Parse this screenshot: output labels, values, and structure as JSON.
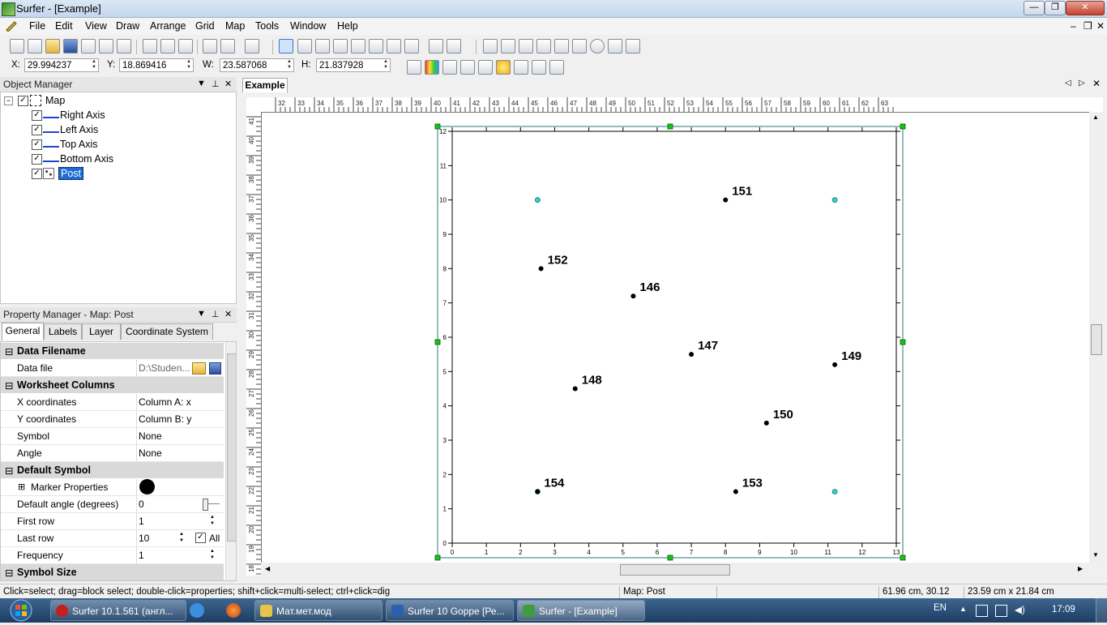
{
  "window": {
    "title": "Surfer - [Example]",
    "controls": {
      "minimize": "—",
      "maximize": "❐",
      "close": "✕"
    }
  },
  "menu": [
    "File",
    "Edit",
    "View",
    "Draw",
    "Arrange",
    "Grid",
    "Map",
    "Tools",
    "Window",
    "Help"
  ],
  "mdi_controls": {
    "minimize": "–",
    "restore": "❐",
    "close": "✕"
  },
  "coords": {
    "x_label": "X:",
    "x_value": "29.994237",
    "y_label": "Y:",
    "y_value": "18.869416",
    "w_label": "W:",
    "w_value": "23.587068",
    "h_label": "H:",
    "h_value": "21.837928"
  },
  "object_manager": {
    "title": "Object Manager",
    "items": [
      {
        "label": "Map",
        "checked": true
      },
      {
        "label": "Right Axis",
        "checked": true
      },
      {
        "label": "Left Axis",
        "checked": true
      },
      {
        "label": "Top Axis",
        "checked": true
      },
      {
        "label": "Bottom Axis",
        "checked": true
      },
      {
        "label": "Post",
        "checked": true,
        "selected": true
      }
    ]
  },
  "property_manager": {
    "title": "Property Manager - Map: Post",
    "tabs": [
      "General",
      "Labels",
      "Layer",
      "Coordinate System"
    ],
    "active_tab": "General",
    "sections": {
      "data_filename": "Data Filename",
      "worksheet_columns": "Worksheet Columns",
      "default_symbol": "Default Symbol",
      "symbol_size": "Symbol Size"
    },
    "rows": {
      "data_file": {
        "name": "Data file",
        "value": "D:\\Studen..."
      },
      "x_coords": {
        "name": "X coordinates",
        "value": "Column A:  x"
      },
      "y_coords": {
        "name": "Y coordinates",
        "value": "Column B:  y"
      },
      "symbol": {
        "name": "Symbol",
        "value": "None"
      },
      "angle": {
        "name": "Angle",
        "value": "None"
      },
      "marker": {
        "name": "Marker Properties"
      },
      "default_angle": {
        "name": "Default angle (degrees)",
        "value": "0"
      },
      "first_row": {
        "name": "First row",
        "value": "1"
      },
      "last_row": {
        "name": "Last row",
        "value": "10",
        "all_label": "All"
      },
      "frequency": {
        "name": "Frequency",
        "value": "1"
      }
    }
  },
  "document": {
    "tab": "Example"
  },
  "ruler": {
    "top": [
      "32",
      "33",
      "34",
      "35",
      "36",
      "37",
      "38",
      "39",
      "40",
      "41",
      "42",
      "43",
      "44",
      "45",
      "46",
      "47",
      "48",
      "49",
      "50",
      "51",
      "52",
      "53",
      "54",
      "55",
      "56",
      "57",
      "58",
      "59",
      "60",
      "61",
      "62",
      "63"
    ],
    "left": [
      "41",
      "40",
      "39",
      "38",
      "37",
      "36",
      "35",
      "34",
      "33",
      "32",
      "31",
      "30",
      "29",
      "28",
      "27",
      "26",
      "25",
      "24",
      "23",
      "22",
      "21",
      "20",
      "19",
      "18"
    ]
  },
  "chart_data": {
    "type": "scatter",
    "x_ticks": [
      0,
      1,
      2,
      3,
      4,
      5,
      6,
      7,
      8,
      9,
      10,
      11,
      12,
      13
    ],
    "y_ticks": [
      0,
      1,
      2,
      3,
      4,
      5,
      6,
      7,
      8,
      9,
      10,
      11,
      12
    ],
    "xlim": [
      0,
      13
    ],
    "ylim": [
      0,
      12
    ],
    "points": [
      {
        "x": 8.0,
        "y": 10.0,
        "label": "151"
      },
      {
        "x": 2.6,
        "y": 8.0,
        "label": "152"
      },
      {
        "x": 5.3,
        "y": 7.2,
        "label": "146"
      },
      {
        "x": 7.0,
        "y": 5.5,
        "label": "147"
      },
      {
        "x": 11.2,
        "y": 5.2,
        "label": "149"
      },
      {
        "x": 3.6,
        "y": 4.5,
        "label": "148"
      },
      {
        "x": 9.2,
        "y": 3.5,
        "label": "150"
      },
      {
        "x": 2.5,
        "y": 1.5,
        "label": "154"
      },
      {
        "x": 8.3,
        "y": 1.5,
        "label": "153"
      }
    ],
    "selection_handles": [
      {
        "x": 2.5,
        "y": 10.0
      },
      {
        "x": 11.2,
        "y": 10.0
      },
      {
        "x": 2.5,
        "y": 1.5
      },
      {
        "x": 11.2,
        "y": 1.5
      }
    ],
    "marker_color": "#000000",
    "handle_color": "#2fd3d3",
    "grid": false
  },
  "status": {
    "hint": "Click=select; drag=block select; double-click=properties; shift+click=multi-select; ctrl+click=dig",
    "object": "Map: Post",
    "position": "61.96 cm, 30.12 cm",
    "size": "23.59 cm x 21.84 cm"
  },
  "taskbar": {
    "items": [
      {
        "label": "Surfer 10.1.561 (англ...",
        "color": "#c81e1e"
      },
      {
        "label": "Мат.мет.мод",
        "color": "#e7c54a"
      },
      {
        "label": "Surfer 10 Goppe [Ре...",
        "color": "#2b5fb0"
      },
      {
        "label": "Surfer - [Example]",
        "color": "#3f9d3f"
      }
    ],
    "lang": "EN",
    "clock": "17:09"
  },
  "colors": {
    "accent": "#3399ff",
    "selection": "#1c6bd6"
  }
}
